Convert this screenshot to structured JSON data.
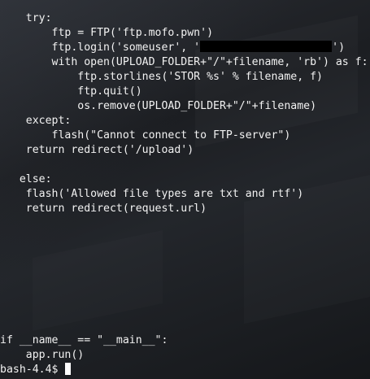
{
  "code": {
    "l1": "    try:",
    "l2": "        ftp = FTP('ftp.mofo.pwn')",
    "l3a": "        ftp.login('someuser', '",
    "l3b": "')",
    "l4": "        with open(UPLOAD_FOLDER+\"/\"+filename, 'rb') as f:",
    "l5": "            ftp.storlines('STOR %s' % filename, f)",
    "l6": "            ftp.quit()",
    "l7": "            os.remove(UPLOAD_FOLDER+\"/\"+filename)",
    "l8": "    except:",
    "l9": "        flash(\"Cannot connect to FTP-server\")",
    "l10": "    return redirect('/upload')",
    "l11": "   else:",
    "l12": "    flash('Allowed file types are txt and rtf')",
    "l13": "    return redirect(request.url)",
    "l14": "if __name__ == \"__main__\":",
    "l15": "    app.run()"
  },
  "prompt": {
    "text": "bash-4.4$ "
  }
}
